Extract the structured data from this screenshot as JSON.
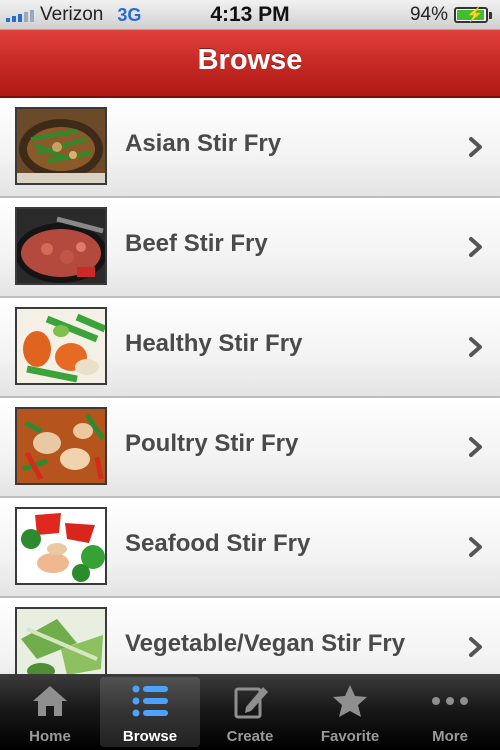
{
  "status_bar": {
    "carrier": "Verizon",
    "network": "3G",
    "time": "4:13 PM",
    "battery": "94%"
  },
  "nav": {
    "title": "Browse"
  },
  "categories": [
    {
      "label": "Asian Stir Fry",
      "icon": "asian-stir-fry-thumbnail"
    },
    {
      "label": "Beef Stir Fry",
      "icon": "beef-stir-fry-thumbnail"
    },
    {
      "label": "Healthy Stir Fry",
      "icon": "healthy-stir-fry-thumbnail"
    },
    {
      "label": "Poultry Stir Fry",
      "icon": "poultry-stir-fry-thumbnail"
    },
    {
      "label": "Seafood Stir Fry",
      "icon": "seafood-stir-fry-thumbnail"
    },
    {
      "label": "Vegetable/Vegan Stir Fry",
      "icon": "vegetable-stir-fry-thumbnail"
    }
  ],
  "tabs": [
    {
      "label": "Home",
      "icon": "home-icon",
      "selected": false
    },
    {
      "label": "Browse",
      "icon": "list-icon",
      "selected": true
    },
    {
      "label": "Create",
      "icon": "pencil-icon",
      "selected": false
    },
    {
      "label": "Favorite",
      "icon": "star-icon",
      "selected": false
    },
    {
      "label": "More",
      "icon": "more-dots-icon",
      "selected": false
    }
  ],
  "colors": {
    "nav_red": "#c62a25",
    "selected_tab_icon": "#4aa3ff",
    "network_blue": "#2a6bd1",
    "battery_green": "#3fbf2a"
  }
}
